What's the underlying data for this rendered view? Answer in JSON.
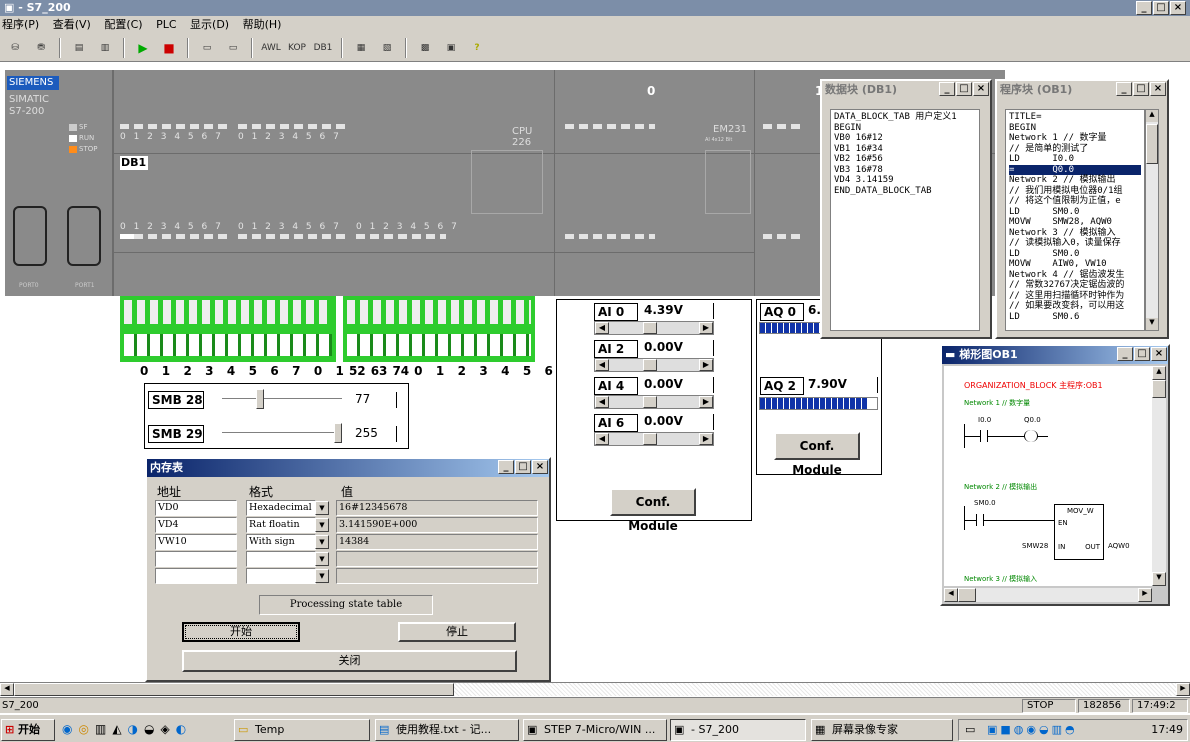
{
  "app": {
    "title": "- S7_200"
  },
  "menu": [
    "程序(P)",
    "查看(V)",
    "配置(C)",
    "PLC",
    "显示(D)",
    "帮助(H)"
  ],
  "toolbar": {
    "awl": "AWL",
    "kop": "KOP",
    "db1": "DB1"
  },
  "plc": {
    "brand": "SIEMENS",
    "model_line1": "SIMATIC",
    "model_line2": "S7-200",
    "leds": {
      "sf": "SF",
      "run": "RUN",
      "stop": "STOP"
    },
    "db1_label": "DB1",
    "cpu": "CPU 226",
    "em": "EM231",
    "em_sub": "AI 4x12 Bit",
    "slot0": "0",
    "slot1": "1",
    "bit_digits": "0 1 2 3 4 5 6 7",
    "port0": "PORT0",
    "port1": "PORT1"
  },
  "inputs": {
    "labels": "0 1 2 3 4 5 6 7 0 1 2 3 4",
    "labels2": "5 6 7 0 1 2 3 4 5 6 7"
  },
  "smb": [
    {
      "label": "SMB 28",
      "value": "77"
    },
    {
      "label": "SMB 29",
      "value": "255"
    }
  ],
  "ai": {
    "channels": [
      {
        "label": "AI 0",
        "value": "4.39V"
      },
      {
        "label": "AI 2",
        "value": "0.00V"
      },
      {
        "label": "AI 4",
        "value": "0.00V"
      },
      {
        "label": "AI 6",
        "value": "0.00V"
      }
    ],
    "conf": "Conf. Module"
  },
  "aq": {
    "channels": [
      {
        "label": "AQ 0",
        "value": "6."
      },
      {
        "label": "AQ 2",
        "value": "7.90V"
      }
    ],
    "conf": "Conf. Module"
  },
  "datablock": {
    "title": "数据块 (DB1)",
    "text": "DATA_BLOCK_TAB 用户定义1\nBEGIN\nVB0 16#12\nVB1 16#34\nVB2 16#56\nVB3 16#78\nVD4 3.14159\nEND_DATA_BLOCK_TAB"
  },
  "program": {
    "title": "程序块 (OB1)",
    "lines": [
      "TITLE=",
      "BEGIN",
      "Network 1 // 数字量",
      "// 是简单的测试了",
      "LD      I0.0",
      "=       Q0.0",
      "Network 2 // 模拟输出",
      "// 我们用模拟电位器0/1组",
      "// 将这个值限制为正值，e",
      "LD      SM0.0",
      "MOVW    SMW28, AQW0",
      "Network 3 // 模拟输入",
      "// 读模拟输入0，读量保存",
      "LD      SM0.0",
      "MOVW    AIW0, VW10",
      "Network 4 //  锯齿波发生",
      "// 常数32767决定锯齿波的",
      "// 这里用扫描循环时钟作为",
      "// 如果要改变斜，可以用这",
      "LD      SM0.6"
    ]
  },
  "ladder": {
    "title": "梯形图OB1",
    "block": "ORGANIZATION_BLOCK 主程序:OB1",
    "n1": "Network 1 // 数字量",
    "c1": "I0.0",
    "c2": "Q0.0",
    "n2": "Network 2 // 模拟输出",
    "c3": "SM0.0",
    "box": "MOV_W",
    "en": "EN",
    "in_label": "SMW28",
    "in": "IN",
    "out": "OUT",
    "out_label": "AQW0",
    "n3": "Network 3 // 模拟输入"
  },
  "memtable": {
    "title": "内存表",
    "h_addr": "地址",
    "h_fmt": "格式",
    "h_val": "值",
    "rows": [
      {
        "addr": "VD0",
        "fmt": "Hexadecimal",
        "val": "16#12345678"
      },
      {
        "addr": "VD4",
        "fmt": "Rat floatin",
        "val": "3.141590E+000"
      },
      {
        "addr": "VW10",
        "fmt": "With sign",
        "val": "14384"
      },
      {
        "addr": "",
        "fmt": "",
        "val": ""
      },
      {
        "addr": "",
        "fmt": "",
        "val": ""
      }
    ],
    "state": "Processing state table",
    "start": "开始",
    "stop": "停止",
    "close": "关闭"
  },
  "status": {
    "left": "S7_200",
    "mode": "STOP",
    "count": "182856",
    "time": "17:49:2"
  },
  "taskbar": {
    "start": "开始",
    "tasks": [
      "Temp",
      "使用教程.txt - 记...",
      "STEP 7-Micro/WIN ...",
      "- S7_200",
      "屏幕录像专家"
    ],
    "clock": "17:49"
  }
}
